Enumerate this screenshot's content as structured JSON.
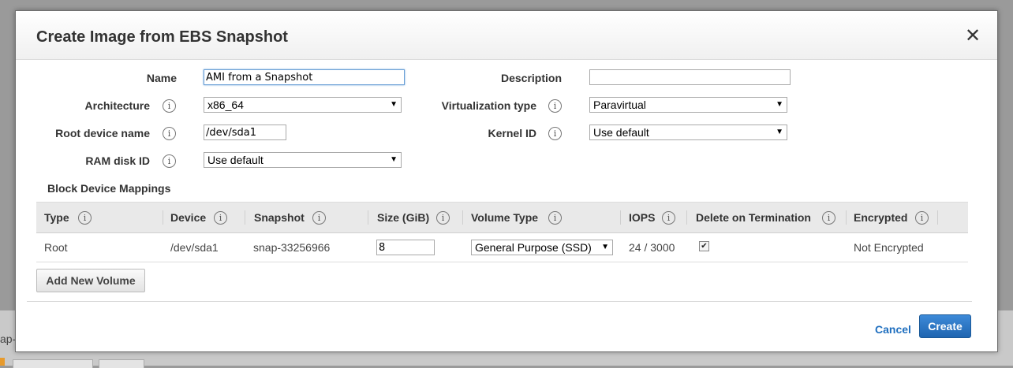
{
  "background": {
    "partial_text": "ap-"
  },
  "dialog": {
    "title": "Create Image from EBS Snapshot",
    "close_label": "✕"
  },
  "form": {
    "name": {
      "label": "Name",
      "value": "AMI from a Snapshot"
    },
    "description": {
      "label": "Description",
      "value": ""
    },
    "architecture": {
      "label": "Architecture",
      "value": "x86_64"
    },
    "virtualization_type": {
      "label": "Virtualization type",
      "value": "Paravirtual"
    },
    "root_device_name": {
      "label": "Root device name",
      "value": "/dev/sda1"
    },
    "kernel_id": {
      "label": "Kernel ID",
      "value": "Use default"
    },
    "ram_disk_id": {
      "label": "RAM disk ID",
      "value": "Use default"
    }
  },
  "block_device_mappings": {
    "title": "Block Device Mappings",
    "columns": [
      "Type",
      "Device",
      "Snapshot",
      "Size (GiB)",
      "Volume Type",
      "IOPS",
      "Delete on Termination",
      "Encrypted"
    ],
    "rows": [
      {
        "type": "Root",
        "device": "/dev/sda1",
        "snapshot": "snap-33256966",
        "size": "8",
        "volume_type": "General Purpose (SSD)",
        "iops": "24 / 3000",
        "delete_on_termination": true,
        "encrypted": "Not Encrypted"
      }
    ],
    "add_button": "Add New Volume"
  },
  "footer": {
    "cancel": "Cancel",
    "create": "Create"
  },
  "icons": {
    "info": "i",
    "dropdown": "▼",
    "check": "✔"
  },
  "colors": {
    "primary_button": "#1f65b1",
    "link": "#1f6fbf"
  }
}
